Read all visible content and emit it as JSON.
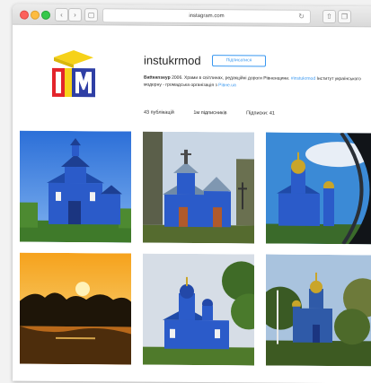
{
  "browser": {
    "url": "instagram.com",
    "back_icon": "chevron-left-icon",
    "forward_icon": "chevron-right-icon",
    "sidebar_icon": "sidebar-icon",
    "reload_icon": "reload-icon",
    "share_icon": "share-icon",
    "tabs_icon": "tabs-icon"
  },
  "profile": {
    "username": "instukrmod",
    "follow_label": "Підписатися",
    "bio_name": "Batteanseyp",
    "bio_year": "2006.",
    "bio_text_1": "Храми в світлинах, редакційні дороги Рівненщини.",
    "bio_link_1": "#instukrmod",
    "bio_text_2": "Інститут українського модерну - громадська організація з",
    "bio_link_2": "Рівне.ua",
    "posts": "43 публікацій",
    "followers": "1м підписників",
    "following": "Підписки: 41"
  },
  "colors": {
    "accent": "#3897f0",
    "church_blue": "#2b5bc9",
    "logo_yellow": "#f6d21a",
    "logo_red": "#e3242b",
    "logo_blue": "#2f3fa5"
  },
  "photos": [
    {
      "label": "blue-wooden-church-1"
    },
    {
      "label": "blue-wooden-church-2"
    },
    {
      "label": "blue-church-through-window"
    },
    {
      "label": "sunset-lake"
    },
    {
      "label": "blue-church-among-trees"
    },
    {
      "label": "church-in-forest"
    }
  ]
}
